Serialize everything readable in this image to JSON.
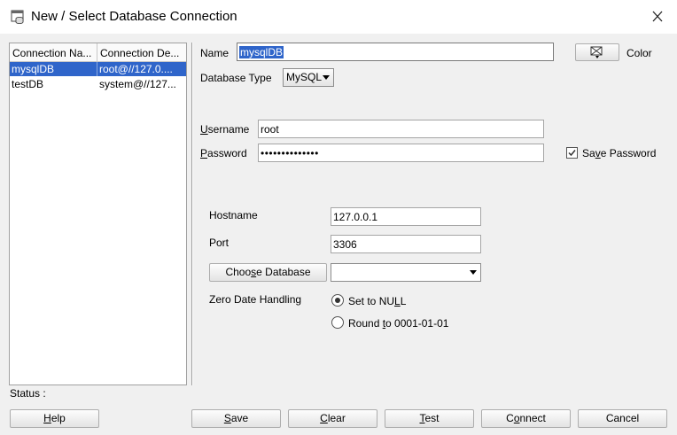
{
  "window": {
    "title": "New / Select Database Connection",
    "icon": "database-connection-icon"
  },
  "connections": {
    "columns": [
      "Connection Na...",
      "Connection De..."
    ],
    "rows": [
      {
        "name": "mysqlDB",
        "details": "root@//127.0....",
        "selected": true
      },
      {
        "name": "testDB",
        "details": "system@//127...",
        "selected": false
      }
    ]
  },
  "form": {
    "name_label": "Name",
    "name_value": "mysqlDB",
    "color_label": "Color",
    "db_type_label": "Database Type",
    "db_type_value": "MySQL",
    "username_label_u": "U",
    "username_label_rest": "sername",
    "username_value": "root",
    "password_label_p": "P",
    "password_label_rest": "assword",
    "password_value": "••••••••••••••",
    "save_password_pre": "Sa",
    "save_password_u": "v",
    "save_password_post": "e Password",
    "save_password_checked": true,
    "hostname_label": "Hostname",
    "hostname_value": "127.0.0.1",
    "port_label": "Port",
    "port_value": "3306",
    "choose_db_pre": "Choo",
    "choose_db_u": "s",
    "choose_db_post": "e Database",
    "choose_db_value": "",
    "zero_date_label": "Zero Date Handling",
    "set_null_pre": "Set to NU",
    "set_null_u": "L",
    "set_null_post": "L",
    "round_pre": "Round ",
    "round_u": "t",
    "round_post": "o 0001-01-01",
    "zero_date_selected": "set_null"
  },
  "status": {
    "label": "Status :"
  },
  "buttons": {
    "help_u": "H",
    "help_rest": "elp",
    "save_u": "S",
    "save_rest": "ave",
    "clear_u": "C",
    "clear_rest": "lear",
    "test_u": "T",
    "test_rest": "est",
    "connect_pre": "C",
    "connect_u": "o",
    "connect_post": "nnect",
    "cancel": "Cancel"
  },
  "colors": {
    "selection": "#2f65ca",
    "background": "#f0f0f0"
  }
}
